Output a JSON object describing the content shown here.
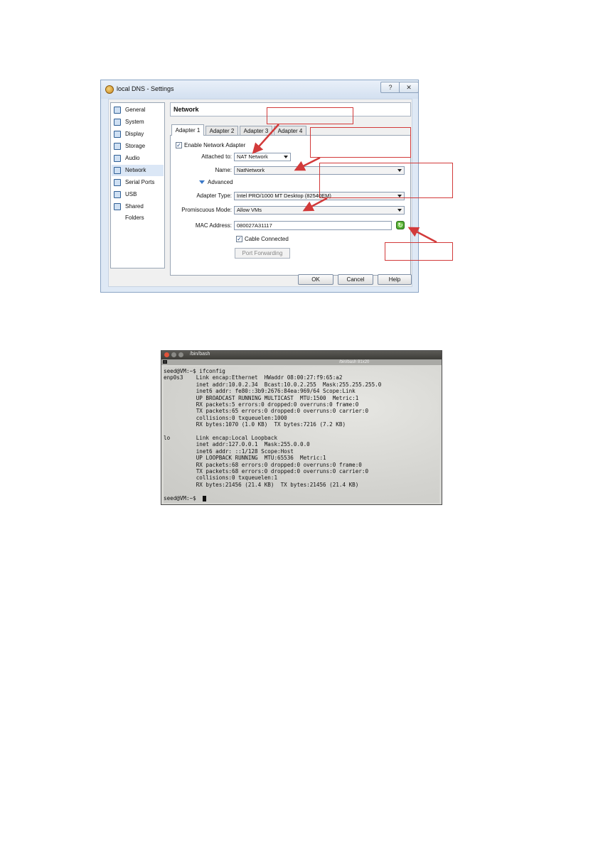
{
  "settings_window": {
    "title": "local DNS - Settings",
    "help_button": "?",
    "close_button": "✕",
    "sidebar": [
      {
        "label": "General",
        "icon": "general-icon"
      },
      {
        "label": "System",
        "icon": "system-icon"
      },
      {
        "label": "Display",
        "icon": "display-icon"
      },
      {
        "label": "Storage",
        "icon": "storage-icon"
      },
      {
        "label": "Audio",
        "icon": "audio-icon"
      },
      {
        "label": "Network",
        "icon": "network-icon",
        "selected": true
      },
      {
        "label": "Serial Ports",
        "icon": "serial-ports-icon"
      },
      {
        "label": "USB",
        "icon": "usb-icon"
      },
      {
        "label": "Shared Folders",
        "icon": "shared-folders-icon"
      }
    ],
    "section_title": "Network",
    "tabs": [
      "Adapter 1",
      "Adapter 2",
      "Adapter 3",
      "Adapter 4"
    ],
    "active_tab": "Adapter 1",
    "enable_adapter_label": "Enable Network Adapter",
    "enable_adapter_checked": true,
    "attached_to_label": "Attached to:",
    "attached_to_value": "NAT Network",
    "name_label": "Name:",
    "name_value": "NatNetwork",
    "advanced_label": "Advanced",
    "adapter_type_label": "Adapter Type:",
    "adapter_type_value": "Intel PRO/1000 MT Desktop (82540EM)",
    "promiscuous_label": "Promiscuous Mode:",
    "promiscuous_value": "Allow VMs",
    "mac_label": "MAC Address:",
    "mac_value": "080027A31117",
    "cable_connected_label": "Cable Connected",
    "cable_connected_checked": true,
    "port_forwarding_label": "Port Forwarding",
    "ok_label": "OK",
    "cancel_label": "Cancel",
    "help_label": "Help"
  },
  "annotation_color": "#d23a3a",
  "terminal": {
    "window_title": "/bin/bash",
    "tab_title": "/bin/bash 81x20",
    "lines": [
      "seed@VM:~$ ifconfig",
      "enp0s3    Link encap:Ethernet  HWaddr 08:00:27:f9:65:a2",
      "          inet addr:10.0.2.34  Bcast:10.0.2.255  Mask:255.255.255.0",
      "          inet6 addr: fe80::3b9:2676:84ea:969/64 Scope:Link",
      "          UP BROADCAST RUNNING MULTICAST  MTU:1500  Metric:1",
      "          RX packets:5 errors:0 dropped:0 overruns:0 frame:0",
      "          TX packets:65 errors:0 dropped:0 overruns:0 carrier:0",
      "          collisions:0 txqueuelen:1000",
      "          RX bytes:1070 (1.0 KB)  TX bytes:7216 (7.2 KB)",
      "",
      "lo        Link encap:Local Loopback",
      "          inet addr:127.0.0.1  Mask:255.0.0.0",
      "          inet6 addr: ::1/128 Scope:Host",
      "          UP LOOPBACK RUNNING  MTU:65536  Metric:1",
      "          RX packets:68 errors:0 dropped:0 overruns:0 frame:0",
      "          TX packets:68 errors:0 dropped:0 overruns:0 carrier:0",
      "          collisions:0 txqueuelen:1",
      "          RX bytes:21456 (21.4 KB)  TX bytes:21456 (21.4 KB)",
      "",
      "seed@VM:~$ "
    ]
  }
}
